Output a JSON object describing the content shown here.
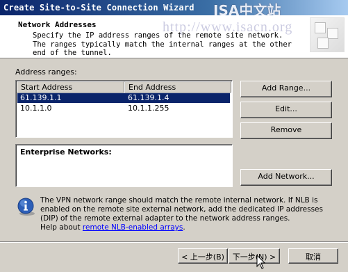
{
  "window": {
    "title": "Create Site-to-Site Connection Wizard"
  },
  "watermark": {
    "brand": "ISA中文站",
    "url": "http://www.isacn.org"
  },
  "header": {
    "title": "Network Addresses",
    "description": "Specify the IP address ranges of the remote site network. The ranges typically match the internal ranges at the other end of the tunnel."
  },
  "address_ranges": {
    "label": "Address ranges:",
    "columns": [
      "Start Address",
      "End Address"
    ],
    "rows": [
      {
        "start": "61.139.1.1",
        "end": "61.139.1.4",
        "selected": true
      },
      {
        "start": "10.1.1.0",
        "end": "10.1.1.255",
        "selected": false
      }
    ]
  },
  "buttons": {
    "add_range": "Add Range...",
    "edit": "Edit...",
    "remove": "Remove",
    "add_network": "Add Network...",
    "back": "< 上一步(B)",
    "next": "下一步(N) >",
    "cancel": "取消"
  },
  "enterprise": {
    "label": "Enterprise Networks:"
  },
  "info": {
    "text": "The VPN network range should match the remote internal network. If NLB is enabled on the remote site external network, add the dedicated IP addresses (DIP) of the remote external adapter to the network address ranges.",
    "help_prefix": "Help about",
    "help_link": "remote NLB-enabled arrays",
    "help_suffix": "."
  },
  "colors": {
    "titlebar": "#0a246a",
    "selection": "#0a246a",
    "face": "#d4d0c8",
    "link": "#0000ff"
  }
}
